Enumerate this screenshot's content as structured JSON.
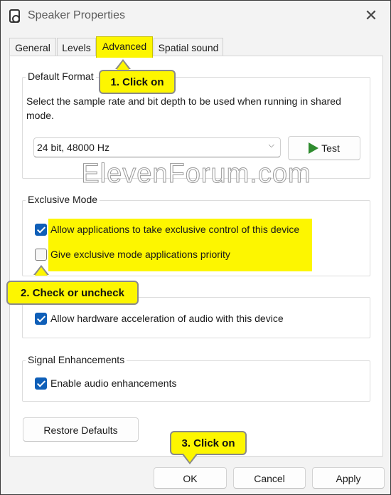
{
  "window": {
    "title": "Speaker Properties",
    "close_glyph": "✕"
  },
  "tabs": [
    {
      "label": "General",
      "selected": false
    },
    {
      "label": "Levels",
      "selected": false
    },
    {
      "label": "Advanced",
      "selected": true
    },
    {
      "label": "Spatial sound",
      "selected": false
    }
  ],
  "default_format": {
    "label": "Default Format",
    "description": "Select the sample rate and bit depth to be used when running in shared mode.",
    "selected_format": "24 bit, 48000 Hz",
    "test_button": "Test"
  },
  "exclusive_mode": {
    "label": "Exclusive Mode",
    "allow_exclusive": {
      "label": "Allow applications to take exclusive control of this device",
      "checked": true
    },
    "give_priority": {
      "label": "Give exclusive mode applications priority",
      "checked": false
    }
  },
  "hardware": {
    "allow_hw_accel": {
      "label": "Allow hardware acceleration of audio with this device",
      "checked": true
    }
  },
  "signal_enhancements": {
    "label": "Signal Enhancements",
    "enable_enhancements": {
      "label": "Enable audio enhancements",
      "checked": true
    }
  },
  "restore_defaults": "Restore Defaults",
  "footer": {
    "ok": "OK",
    "cancel": "Cancel",
    "apply": "Apply"
  },
  "callouts": {
    "step1": "1. Click on",
    "step2": "2. Check or uncheck",
    "step3": "3. Click on"
  },
  "watermark": "ElevenForum.com",
  "colors": {
    "highlight": "#fdf600",
    "checkbox_accent": "#0f5fb8",
    "play_icon": "#2e8b2e"
  }
}
